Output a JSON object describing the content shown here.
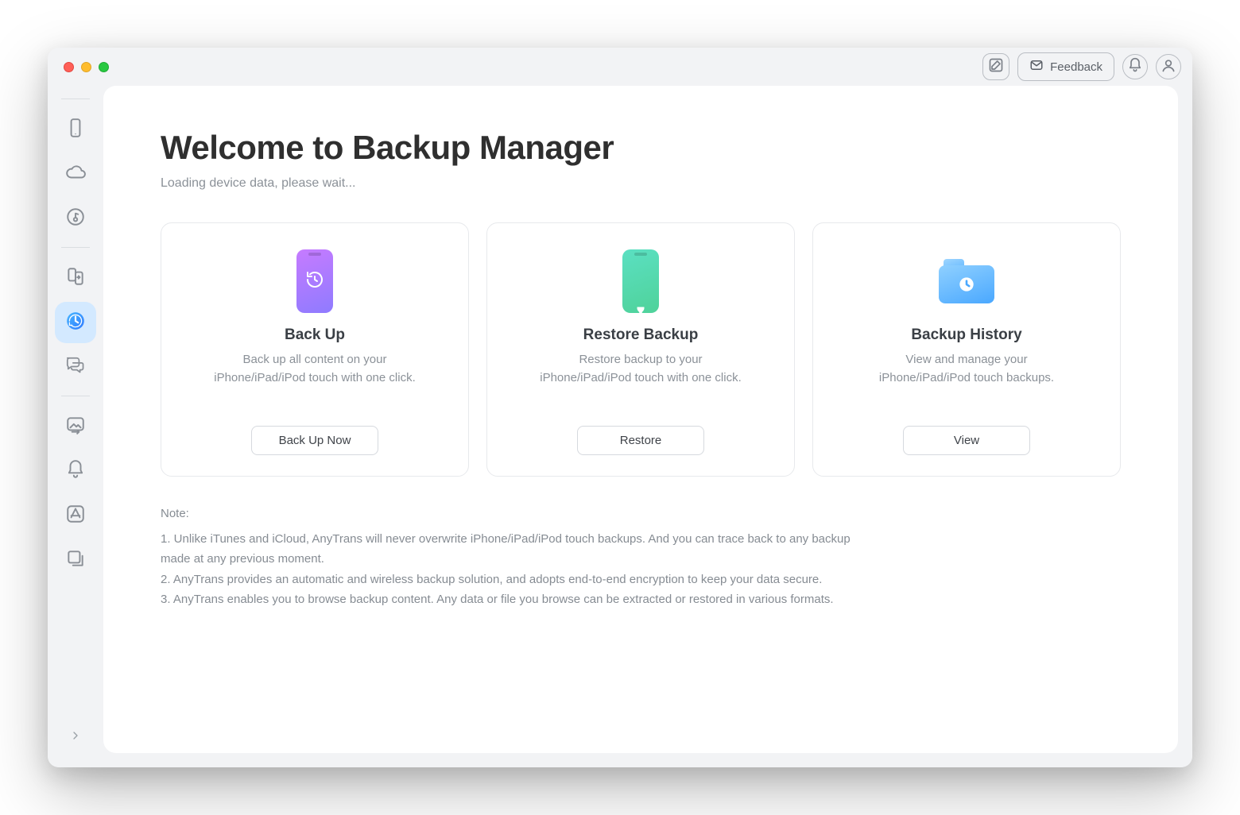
{
  "titlebar": {
    "feedback_label": "Feedback"
  },
  "sidebar": {
    "items": [
      {
        "name": "device",
        "active": false
      },
      {
        "name": "cloud",
        "active": false
      },
      {
        "name": "media",
        "active": false
      },
      {
        "name": "transfer",
        "active": false
      },
      {
        "name": "backup",
        "active": true
      },
      {
        "name": "messages",
        "active": false
      },
      {
        "name": "photos",
        "active": false
      },
      {
        "name": "ringtone-bell",
        "active": false
      },
      {
        "name": "apps",
        "active": false
      },
      {
        "name": "mirror",
        "active": false
      }
    ]
  },
  "page": {
    "title": "Welcome to Backup Manager",
    "subtitle": "Loading device data, please wait..."
  },
  "cards": [
    {
      "title": "Back Up",
      "desc": "Back up all content on your iPhone/iPad/iPod touch with one click.",
      "button": "Back Up Now"
    },
    {
      "title": "Restore Backup",
      "desc": "Restore backup to your iPhone/iPad/iPod touch with one click.",
      "button": "Restore"
    },
    {
      "title": "Backup History",
      "desc": "View and manage your iPhone/iPad/iPod touch backups.",
      "button": "View"
    }
  ],
  "notes": {
    "heading": "Note:",
    "items": [
      "1. Unlike iTunes and iCloud, AnyTrans will never overwrite iPhone/iPad/iPod touch backups. And you can trace back to any backup made at any previous moment.",
      "2. AnyTrans provides an automatic and wireless backup solution, and adopts end-to-end encryption to keep your data secure.",
      "3. AnyTrans enables you to browse backup content. Any data or file you browse can be extracted or restored in various formats."
    ]
  }
}
